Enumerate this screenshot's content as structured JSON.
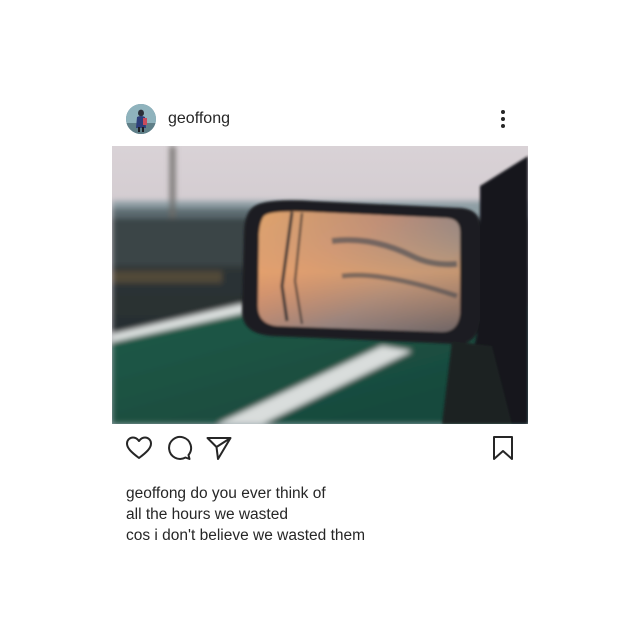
{
  "post": {
    "username": "geoffong",
    "caption_username": "geoffong",
    "caption_lines": [
      "do you ever think of",
      "all the hours we wasted",
      "cos i don't believe we wasted them"
    ]
  },
  "icons": {
    "avatar": "profile-avatar",
    "more": "more-options-icon",
    "like": "heart-icon",
    "comment": "comment-bubble-icon",
    "share": "paper-plane-icon",
    "save": "bookmark-icon"
  },
  "colors": {
    "text": "#262626",
    "background": "#ffffff"
  }
}
